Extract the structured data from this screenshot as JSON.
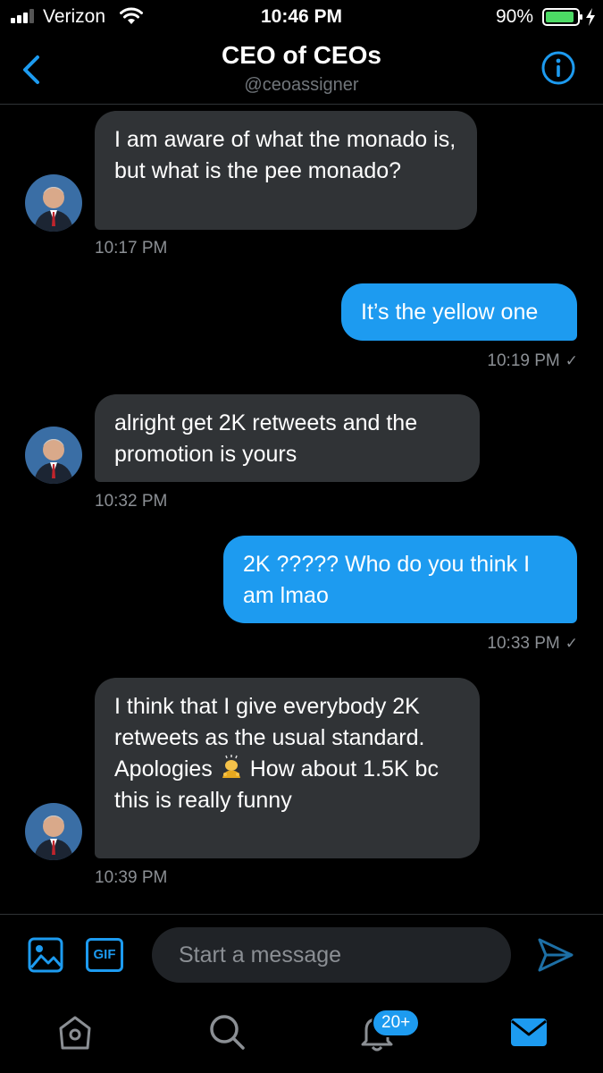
{
  "status_bar": {
    "carrier": "Verizon",
    "time": "10:46 PM",
    "battery": "90%"
  },
  "header": {
    "name": "CEO of CEOs",
    "handle": "@ceoassigner"
  },
  "messages": [
    {
      "from": "them",
      "text": "I am aware of what the monado is, but what is the pee monado?",
      "time": "10:17 PM"
    },
    {
      "from": "me",
      "text": "It’s the yellow one",
      "time": "10:19 PM"
    },
    {
      "from": "them",
      "text": "alright get 2K retweets and the promotion is yours",
      "time": "10:32 PM"
    },
    {
      "from": "me",
      "text": "2K ????? Who do you think I am lmao",
      "time": "10:33 PM"
    },
    {
      "from": "them",
      "text_before_emoji": "I think that I give everybody 2K retweets as the usual standard. Apologies",
      "emoji": "person-bowing-emoji",
      "text_after_emoji": "How about 1.5K bc this is really funny",
      "time": "10:39 PM"
    }
  ],
  "compose": {
    "placeholder": "Start a message",
    "gif_label": "GIF"
  },
  "tabbar": {
    "notifications_badge": "20+"
  },
  "colors": {
    "accent": "#1d9bf0",
    "incoming_bubble": "#303336",
    "background": "#000000"
  }
}
